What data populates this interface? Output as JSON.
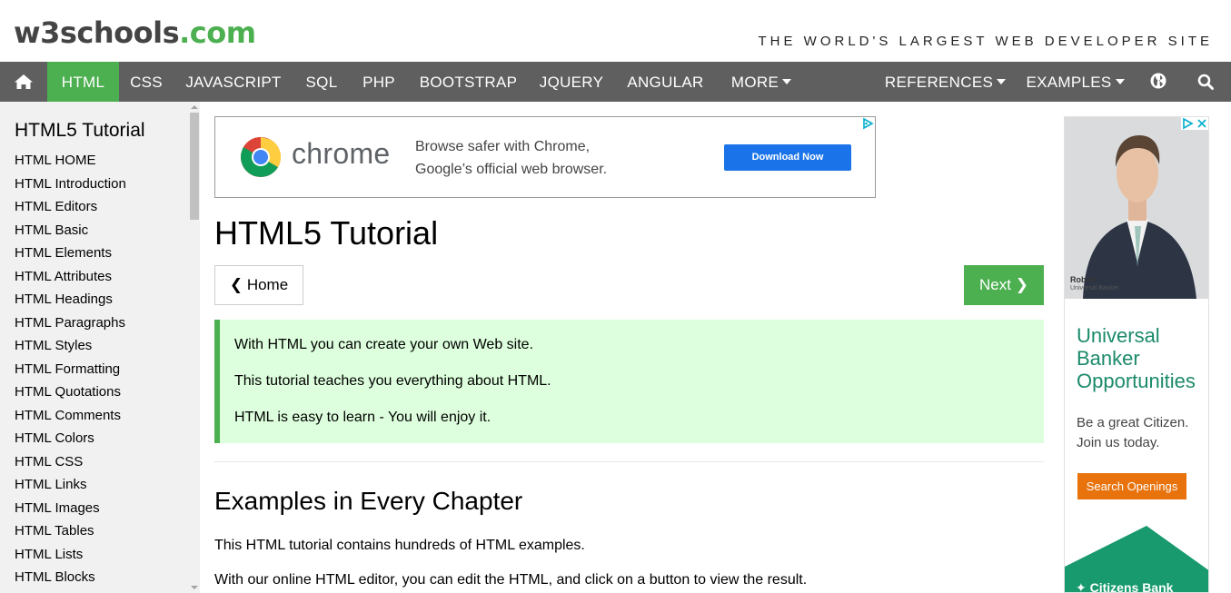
{
  "header": {
    "logo_part1": "w3schools",
    "logo_part2": ".com",
    "tagline": "THE WORLD'S LARGEST WEB DEVELOPER SITE"
  },
  "nav": {
    "items": [
      {
        "label": "HTML"
      },
      {
        "label": "CSS"
      },
      {
        "label": "JAVASCRIPT"
      },
      {
        "label": "SQL"
      },
      {
        "label": "PHP"
      },
      {
        "label": "BOOTSTRAP"
      },
      {
        "label": "JQUERY"
      },
      {
        "label": "ANGULAR"
      },
      {
        "label": "MORE"
      },
      {
        "label": "REFERENCES"
      },
      {
        "label": "EXAMPLES"
      }
    ],
    "active": "HTML",
    "colors": {
      "bar": "#5f5f5f",
      "active": "#4caf50"
    }
  },
  "sidebar": {
    "title": "HTML5 Tutorial",
    "items": [
      "HTML HOME",
      "HTML Introduction",
      "HTML Editors",
      "HTML Basic",
      "HTML Elements",
      "HTML Attributes",
      "HTML Headings",
      "HTML Paragraphs",
      "HTML Styles",
      "HTML Formatting",
      "HTML Quotations",
      "HTML Comments",
      "HTML Colors",
      "HTML CSS",
      "HTML Links",
      "HTML Images",
      "HTML Tables",
      "HTML Lists",
      "HTML Blocks"
    ]
  },
  "ad_chrome": {
    "brand": "chrome",
    "text_line1": "Browse safer with Chrome,",
    "text_line2": "Google’s official web browser.",
    "button": "Download Now"
  },
  "main": {
    "title": "HTML5 Tutorial",
    "home_button": "Home",
    "next_button": "Next",
    "note_lines": [
      "With HTML you can create your own Web site.",
      "This tutorial teaches you everything about HTML.",
      "HTML is easy to learn - You will enjoy it."
    ],
    "section_title": "Examples in Every Chapter",
    "section_paragraphs": [
      "This HTML tutorial contains hundreds of HTML examples.",
      "With our online HTML editor, you can edit the HTML, and click on a button to view the result."
    ]
  },
  "ad_bank": {
    "person_name": "Robert",
    "person_role": "Universal Banker",
    "headline_line1": "Universal",
    "headline_line2": "Banker",
    "headline_line3": "Opportunities",
    "sub_line1": "Be a great Citizen.",
    "sub_line2": "Join us today.",
    "button": "Search Openings",
    "brand": "Citizens Bank",
    "colors": {
      "green": "#1b8a6b",
      "button": "#e8730c"
    }
  }
}
